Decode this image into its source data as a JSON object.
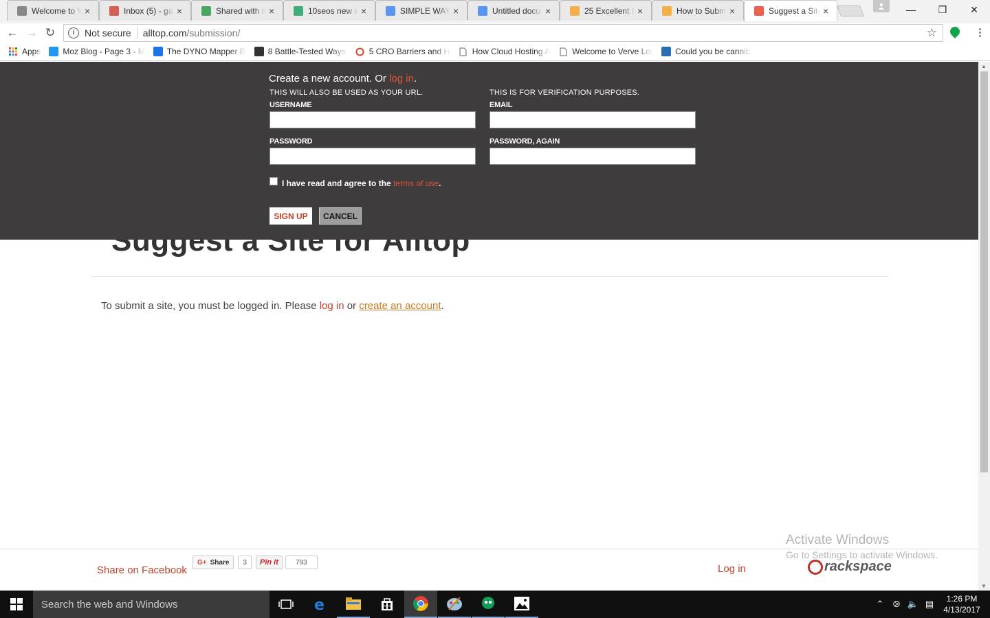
{
  "tabs": [
    {
      "title": "Welcome to V",
      "icon": "doc-icon",
      "color": "#777"
    },
    {
      "title": "Inbox (5) - ga",
      "icon": "gmail-icon",
      "color": "#d44638"
    },
    {
      "title": "Shared with m",
      "icon": "drive-icon",
      "color": "#2e9b4a"
    },
    {
      "title": "10seos new k",
      "icon": "sheets-icon",
      "color": "#21a366"
    },
    {
      "title": "SIMPLE WAYS",
      "icon": "docs-icon",
      "color": "#4285f4"
    },
    {
      "title": "Untitled docu",
      "icon": "docs-icon",
      "color": "#4285f4"
    },
    {
      "title": "25 Excellent F",
      "icon": "pin-icon",
      "color": "#f4a52c"
    },
    {
      "title": "How to Subm",
      "icon": "pin-icon",
      "color": "#f4a52c"
    },
    {
      "title": "Suggest a Site",
      "icon": "alltop-icon",
      "color": "#e8452c",
      "active": true
    }
  ],
  "address": {
    "security": "Not secure",
    "domain": "alltop.com",
    "path": "/submission/"
  },
  "bookmarks": [
    {
      "label": "Apps",
      "icon": "apps-grid-icon"
    },
    {
      "label": "Moz Blog - Page 3 - M",
      "icon": "moz-icon"
    },
    {
      "label": "The DYNO Mapper Bl",
      "icon": "dyno-icon"
    },
    {
      "label": "8 Battle-Tested Ways t",
      "icon": "sej-icon"
    },
    {
      "label": "5 CRO Barriers and Ho",
      "icon": "ring-icon"
    },
    {
      "label": "How Cloud Hosting A",
      "icon": "page-icon"
    },
    {
      "label": "Welcome to Verve Log",
      "icon": "page-icon"
    },
    {
      "label": "Could you be canniba",
      "icon": "a-icon"
    }
  ],
  "signup": {
    "title_prefix": "Create a new account. Or ",
    "title_link": "log in",
    "title_suffix": ".",
    "username_hint": "THIS WILL ALSO BE USED AS YOUR URL.",
    "username_label": "USERNAME",
    "email_hint": "THIS IS FOR VERIFICATION PURPOSES.",
    "email_label": "EMAIL",
    "password_label": "PASSWORD",
    "password_again_label": "PASSWORD, AGAIN",
    "terms_prefix": "I have read and agree to the ",
    "terms_link": "terms of use",
    "terms_suffix": ".",
    "signup_button": "SIGN UP",
    "cancel_button": "CANCEL"
  },
  "page": {
    "heading": "Suggest a Site for Alltop",
    "message_prefix": "To submit a site, you must be logged in. Please ",
    "login_link": "log in",
    "message_mid": " or ",
    "create_link": "create an account",
    "message_suffix": "."
  },
  "footer": {
    "facebook": "Share on Facebook",
    "gplus_label": "Share",
    "gplus_prefix": "G+",
    "gplus_count": "3",
    "pin_label": "Pin it",
    "pin_count": "793",
    "login": "Log in",
    "sponsor": "rackspace"
  },
  "watermark": {
    "line1": "Activate Windows",
    "line2": "Go to Settings to activate Windows."
  },
  "taskbar": {
    "search_placeholder": "Search the web and Windows",
    "time": "1:26 PM",
    "date": "4/13/2017"
  }
}
